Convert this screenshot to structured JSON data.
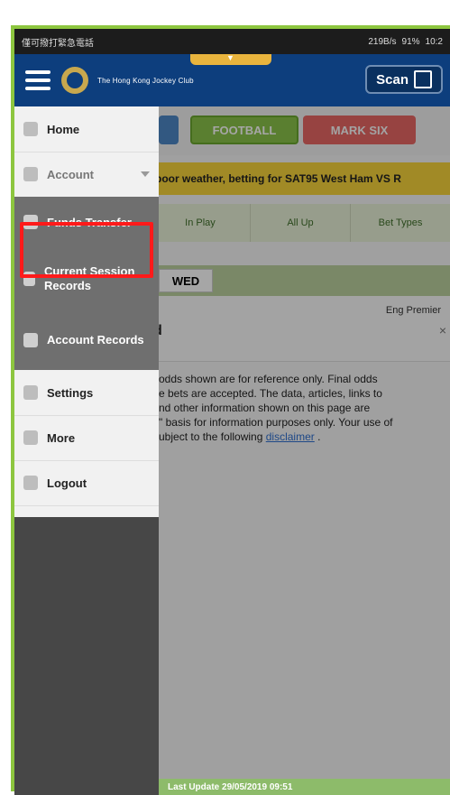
{
  "status": {
    "left_text": "僅可撥打緊急電話",
    "right_text": "219B/s",
    "battery": "91%",
    "time": "10:2"
  },
  "app": {
    "brand": "The Hong Kong Jockey Club",
    "scan_label": "Scan"
  },
  "sports_tabs": [
    {
      "label": ""
    },
    {
      "label": "FOOTBALL"
    },
    {
      "label": "MARK SIX"
    }
  ],
  "notice_text": "poor weather, betting for SAT95 West Ham VS R",
  "bet_nav": [
    "In Play",
    "All Up",
    "Bet Types"
  ],
  "day_label": "WED",
  "league": {
    "name": "Eng Premier",
    "title_fragment": "d",
    "close_icon": "×"
  },
  "disclaimer": {
    "lines": [
      "odds shown are for reference only. Final odds",
      "e bets are accepted. The data, articles, links to",
      "nd other information shown on this page are",
      "\" basis for information purposes only. Your use of",
      "ubject to the following "
    ],
    "link_text": "disclaimer",
    "end_punct": "."
  },
  "footer_text": "Last Update 29/05/2019 09:51",
  "drawer": {
    "items": [
      {
        "label": "Home",
        "icon": "home-icon",
        "state": "normal"
      },
      {
        "label": "Account",
        "icon": "account-icon",
        "state": "dim"
      },
      {
        "label": "Funds Transfer",
        "icon": "transfer-icon",
        "state": "dark"
      },
      {
        "label": "Current Session Records",
        "icon": "list-icon",
        "state": "dark"
      },
      {
        "label": "Account Records",
        "icon": "records-icon",
        "state": "dark"
      },
      {
        "label": "Settings",
        "icon": "settings-icon",
        "state": "normal"
      },
      {
        "label": "More",
        "icon": "more-icon",
        "state": "normal"
      },
      {
        "label": "Logout",
        "icon": "logout-icon",
        "state": "normal"
      }
    ]
  },
  "colors": {
    "appbar": "#0d3e7d",
    "green": "#8dc63f",
    "red_highlight": "#ff1a1a"
  }
}
